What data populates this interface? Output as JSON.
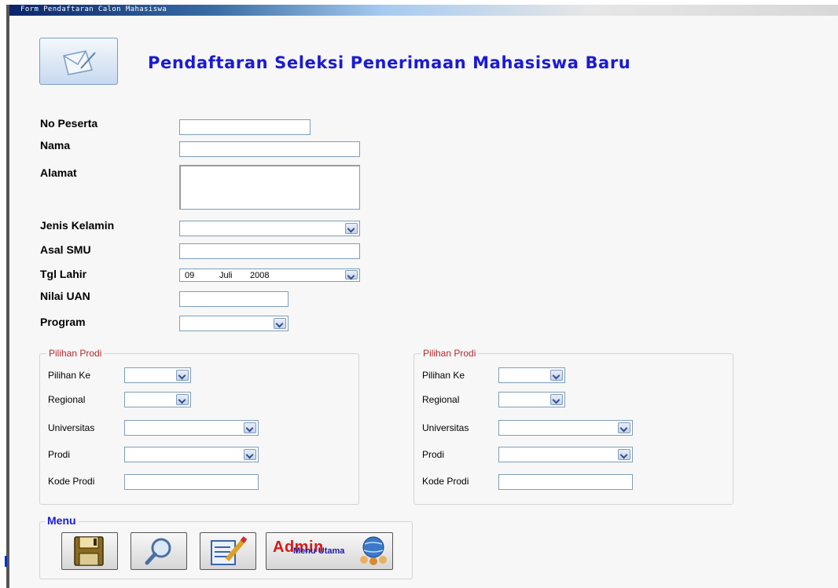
{
  "window": {
    "title": "Form Pendaftaran Calon Mahasiswa"
  },
  "header": {
    "title": "Pendaftaran Seleksi Penerimaan Mahasiswa Baru",
    "logo_icon": "form-edit-icon"
  },
  "fields": {
    "no_peserta": {
      "label": "No Peserta",
      "value": ""
    },
    "nama": {
      "label": "Nama",
      "value": ""
    },
    "alamat": {
      "label": "Alamat",
      "value": ""
    },
    "jenis_kelamin": {
      "label": "Jenis Kelamin",
      "value": ""
    },
    "asal_smu": {
      "label": "Asal SMU",
      "value": ""
    },
    "tgl_lahir": {
      "label": "Tgl Lahir",
      "day": "09",
      "month": "Juli",
      "year": "2008"
    },
    "nilai_uan": {
      "label": "Nilai UAN",
      "value": ""
    },
    "program": {
      "label": "Program",
      "value": ""
    }
  },
  "pilihan_groups": [
    {
      "legend": "Pilihan Prodi",
      "pilihan_ke_label": "Pilihan Ke",
      "regional_label": "Regional",
      "universitas_label": "Universitas",
      "prodi_label": "Prodi",
      "kode_prodi_label": "Kode Prodi"
    },
    {
      "legend": "Pilihan Prodi",
      "pilihan_ke_label": "Pilihan Ke",
      "regional_label": "Regional",
      "universitas_label": "Universitas",
      "prodi_label": "Prodi",
      "kode_prodi_label": "Kode Prodi"
    }
  ],
  "menu": {
    "legend": "Menu",
    "buttons": [
      {
        "name": "save",
        "icon": "floppy-disk-icon"
      },
      {
        "name": "search",
        "icon": "magnifier-icon"
      },
      {
        "name": "edit",
        "icon": "edit-form-icon"
      },
      {
        "name": "admin",
        "label": "Admin",
        "sublabel": "Menu Utama",
        "icon": "globe-users-icon"
      }
    ]
  },
  "colors": {
    "title_blue": "#1a1ad6",
    "legend_red": "#b3282d",
    "field_border": "#7f9db9"
  }
}
